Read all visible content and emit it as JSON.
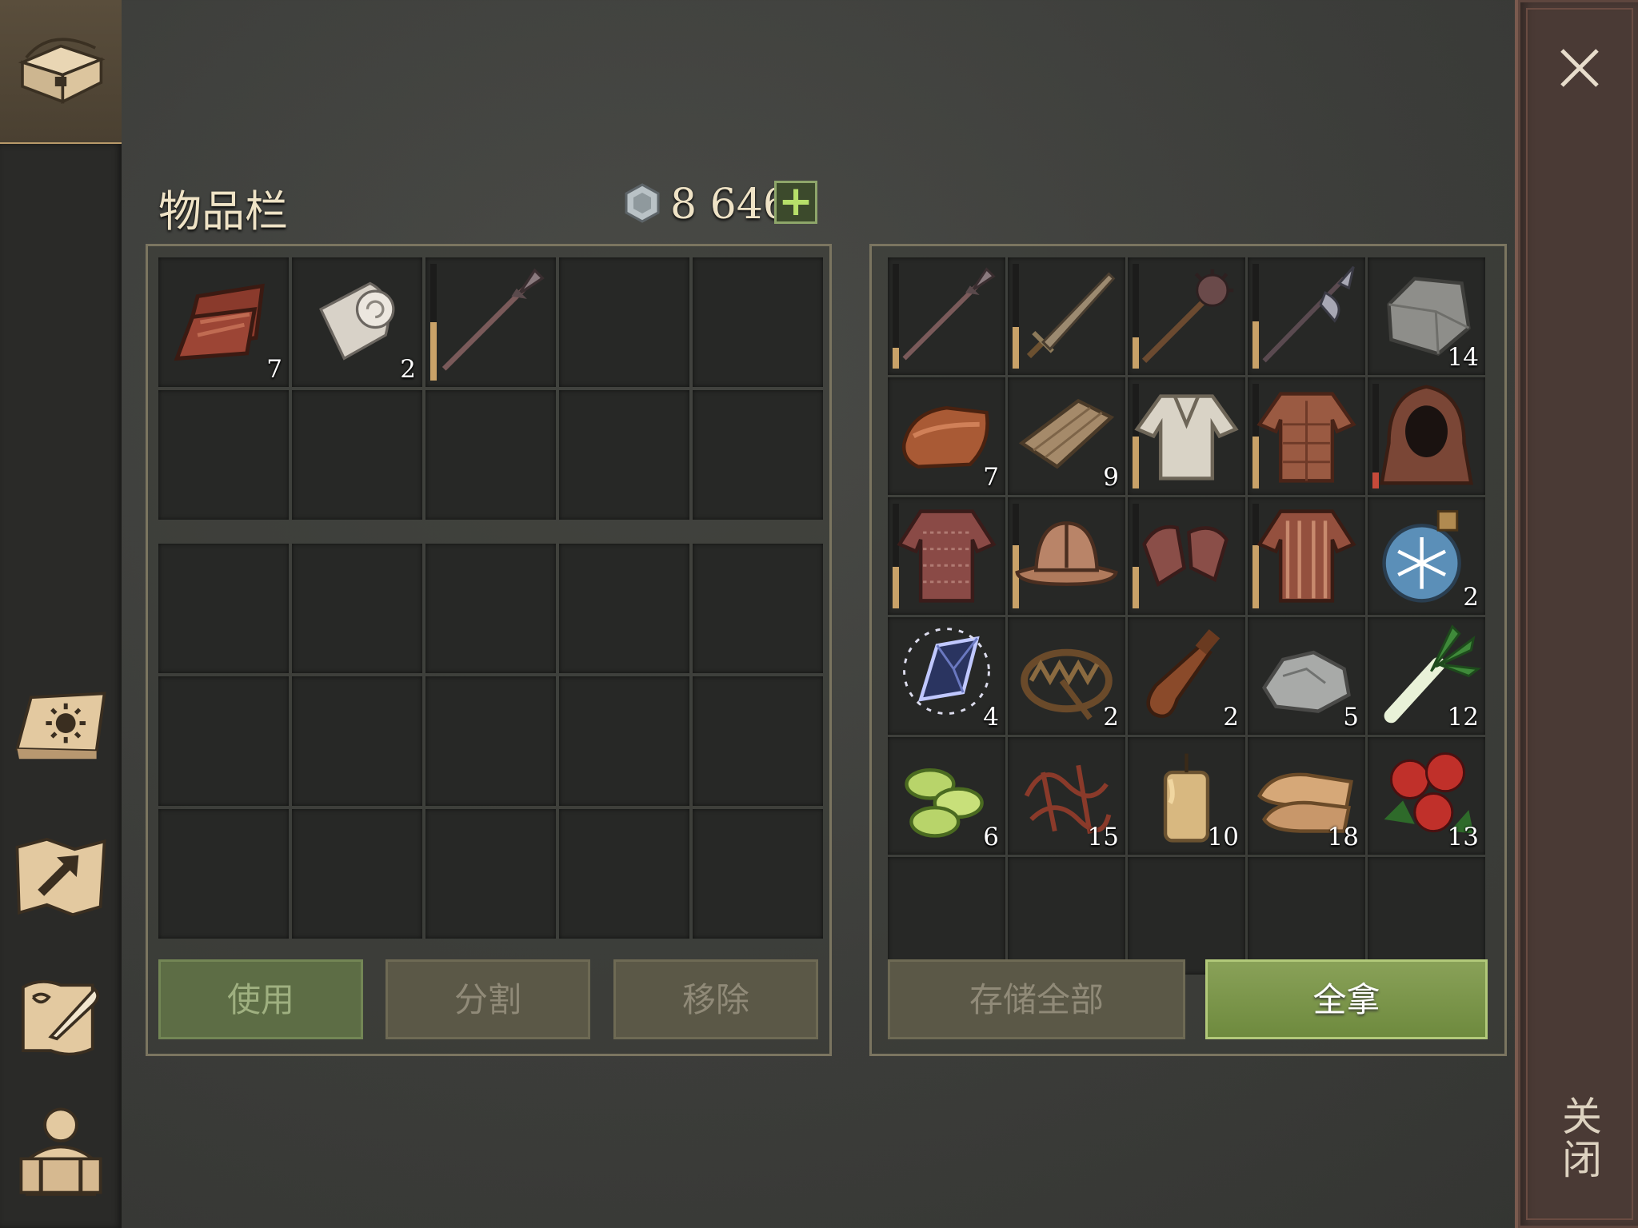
{
  "title": "物品栏",
  "currency": {
    "amount": "8 646",
    "plus": "+"
  },
  "close_label": "关闭",
  "player_inventory": {
    "top": [
      {
        "name": "leather",
        "count": "7"
      },
      {
        "name": "cloth-roll",
        "count": "2"
      },
      {
        "name": "spear",
        "count": "",
        "durability": 0.5
      }
    ]
  },
  "chest_inventory": [
    {
      "name": "spear",
      "count": "",
      "durability": 0.2
    },
    {
      "name": "sword",
      "count": "",
      "durability": 0.4
    },
    {
      "name": "morning-star",
      "count": "",
      "durability": 0.3
    },
    {
      "name": "halberd",
      "count": "",
      "durability": 0.45
    },
    {
      "name": "stone",
      "count": "14"
    },
    {
      "name": "copper-ingot",
      "count": "7"
    },
    {
      "name": "wood-planks",
      "count": "9"
    },
    {
      "name": "linen-shirt",
      "count": "",
      "durability": 0.5
    },
    {
      "name": "gambeson",
      "count": "",
      "durability": 0.5
    },
    {
      "name": "hood",
      "count": "",
      "durability": 0.15
    },
    {
      "name": "chainmail",
      "count": "",
      "durability": 0.4
    },
    {
      "name": "kettle-helmet",
      "count": "",
      "durability": 0.6
    },
    {
      "name": "chain-gloves",
      "count": "",
      "durability": 0.4
    },
    {
      "name": "padded-jacket",
      "count": "",
      "durability": 0.6
    },
    {
      "name": "frost-potion",
      "count": "2"
    },
    {
      "name": "crystal",
      "count": "4"
    },
    {
      "name": "bear-trap",
      "count": "2"
    },
    {
      "name": "bottle",
      "count": "2"
    },
    {
      "name": "iron-ore",
      "count": "5"
    },
    {
      "name": "leek",
      "count": "12"
    },
    {
      "name": "cucumber-slices",
      "count": "6"
    },
    {
      "name": "wire-scraps",
      "count": "15"
    },
    {
      "name": "candle",
      "count": "10"
    },
    {
      "name": "fabric",
      "count": "18"
    },
    {
      "name": "berries",
      "count": "13"
    }
  ],
  "buttons": {
    "use": "使用",
    "split": "分割",
    "remove": "移除",
    "store_all": "存储全部",
    "take_all": "全拿"
  },
  "icons": [
    "chest-icon",
    "sun-book-icon",
    "map-icon",
    "quill-scroll-icon",
    "backpack-icon",
    "coin-icon",
    "close-icon"
  ]
}
